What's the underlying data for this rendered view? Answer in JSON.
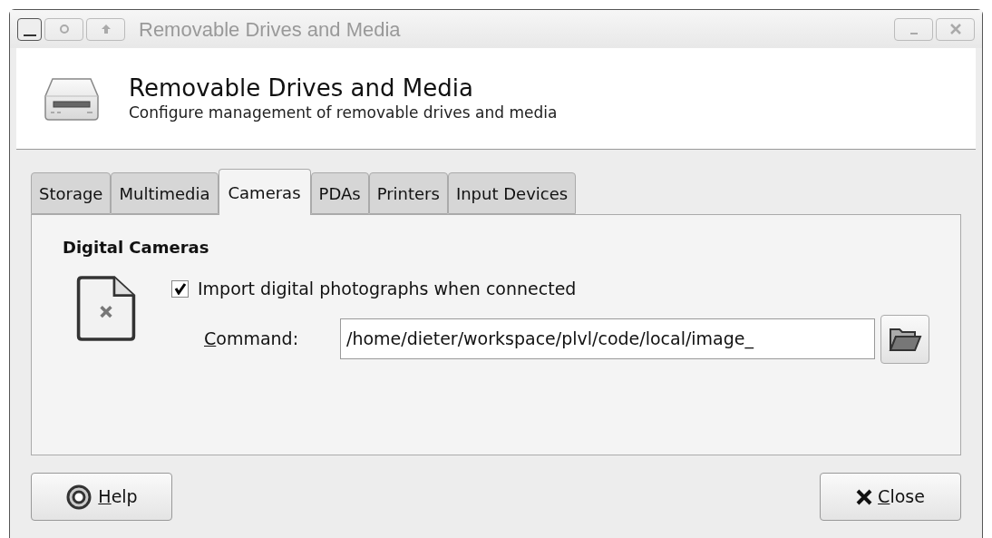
{
  "window": {
    "title": "Removable Drives and Media"
  },
  "header": {
    "title": "Removable Drives and Media",
    "subtitle": "Configure management of removable drives and media"
  },
  "tabs": [
    {
      "label": "Storage",
      "selected": false
    },
    {
      "label": "Multimedia",
      "selected": false
    },
    {
      "label": "Cameras",
      "selected": true
    },
    {
      "label": "PDAs",
      "selected": false
    },
    {
      "label": "Printers",
      "selected": false
    },
    {
      "label": "Input Devices",
      "selected": false
    }
  ],
  "section": {
    "title": "Digital Cameras",
    "import": {
      "label": "Import digital photographs when connected",
      "checked": true
    },
    "command": {
      "label": "Command:",
      "value": "/home/dieter/workspace/plvl/code/local/image_"
    }
  },
  "buttons": [
    {
      "kind": "help",
      "label": "Help"
    },
    {
      "kind": "close",
      "label": "Close"
    }
  ]
}
